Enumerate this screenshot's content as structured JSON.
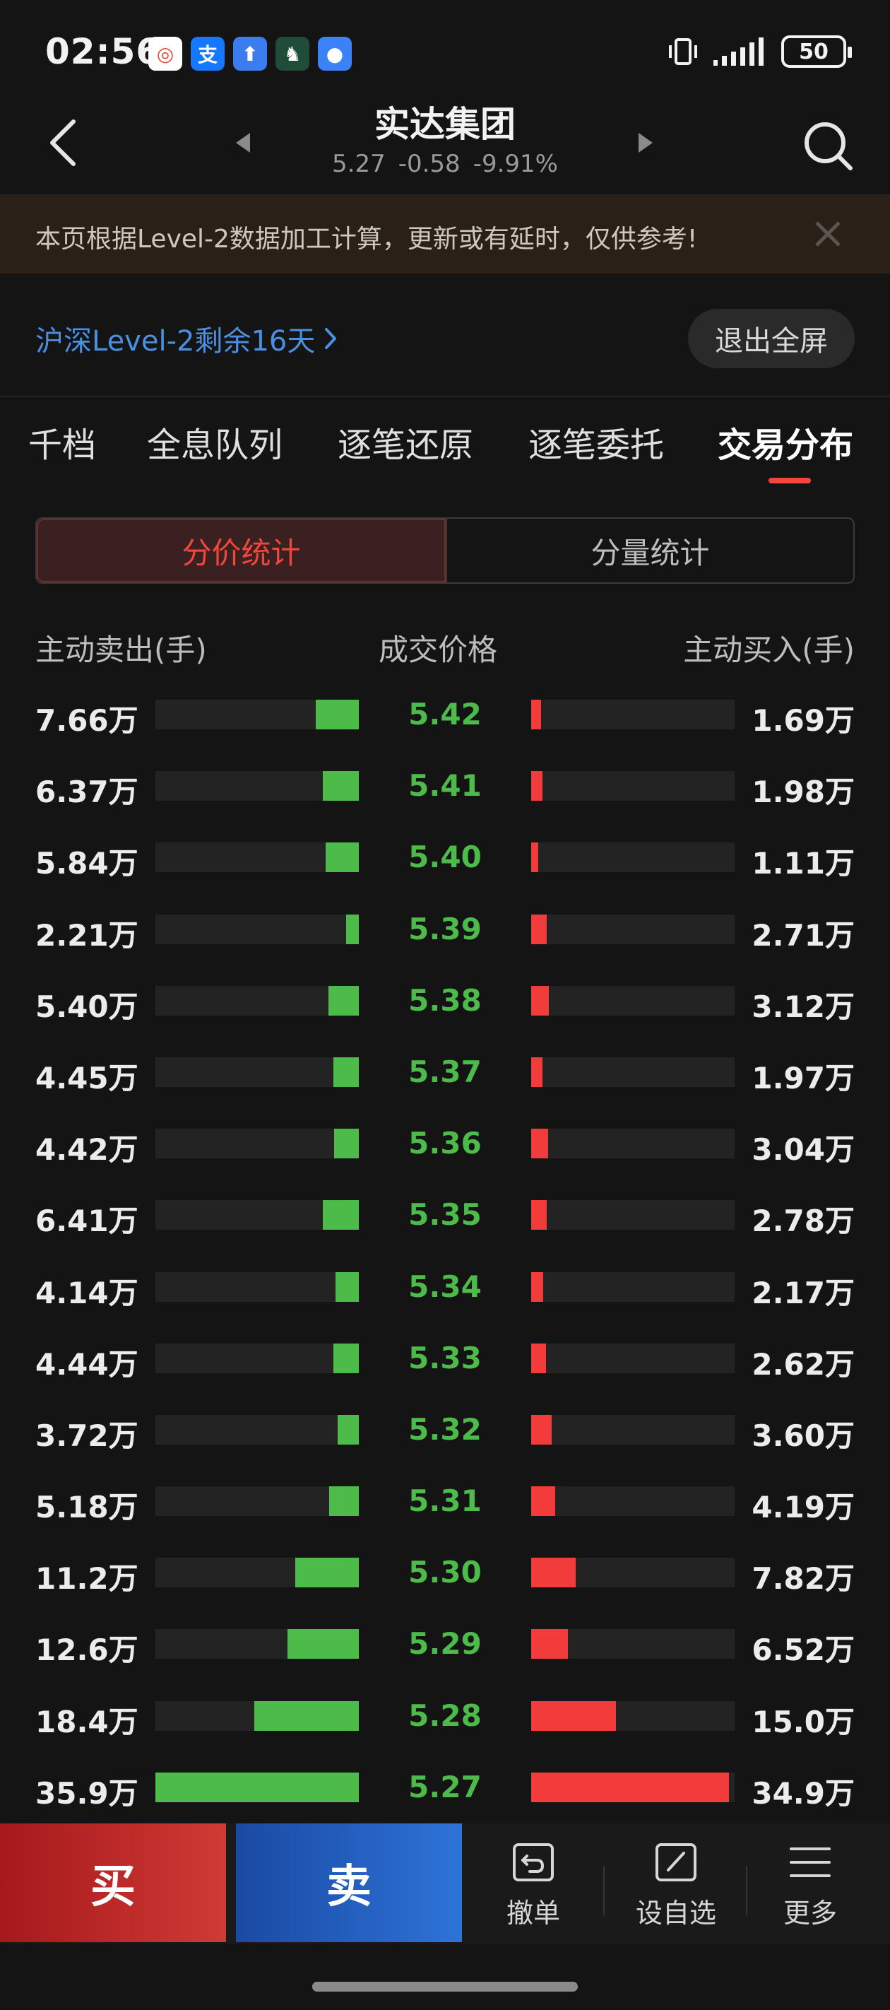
{
  "status": {
    "time": "02:56",
    "battery": "50",
    "notif_icons": [
      {
        "name": "app-icon-1",
        "glyph": "◎",
        "color": "#ffffff"
      },
      {
        "name": "alipay-icon",
        "glyph": "支",
        "color": "#1677ff"
      },
      {
        "name": "upload-app-icon",
        "glyph": "⬆",
        "color": "#3b7cf0"
      },
      {
        "name": "app-icon-4",
        "glyph": "♞",
        "color": "#1f4d3a"
      },
      {
        "name": "message-app-icon",
        "glyph": "●",
        "color": "#3b82f6"
      }
    ]
  },
  "header": {
    "stock_name": "实达集团",
    "price": "5.27",
    "change": "-0.58",
    "change_pct": "-9.91%"
  },
  "notice": {
    "text": "本页根据Level-2数据加工计算，更新或有延时，仅供参考!"
  },
  "level2": {
    "link_text": "沪深Level-2剩余16天",
    "exit_fullscreen": "退出全屏"
  },
  "tabs": [
    "千档",
    "全息队列",
    "逐笔还原",
    "逐笔委托",
    "交易分布"
  ],
  "active_tab": 4,
  "segments": [
    "分价统计",
    "分量统计"
  ],
  "table_head": {
    "sell": "主动卖出(手)",
    "price": "成交价格",
    "buy": "主动买入(手)"
  },
  "rows": [
    {
      "sell": "7.66万",
      "price": "5.42",
      "buy": "1.69万",
      "sell_val": 7.66,
      "buy_val": 1.69
    },
    {
      "sell": "6.37万",
      "price": "5.41",
      "buy": "1.98万",
      "sell_val": 6.37,
      "buy_val": 1.98
    },
    {
      "sell": "5.84万",
      "price": "5.40",
      "buy": "1.11万",
      "sell_val": 5.84,
      "buy_val": 1.11
    },
    {
      "sell": "2.21万",
      "price": "5.39",
      "buy": "2.71万",
      "sell_val": 2.21,
      "buy_val": 2.71
    },
    {
      "sell": "5.40万",
      "price": "5.38",
      "buy": "3.12万",
      "sell_val": 5.4,
      "buy_val": 3.12
    },
    {
      "sell": "4.45万",
      "price": "5.37",
      "buy": "1.97万",
      "sell_val": 4.45,
      "buy_val": 1.97
    },
    {
      "sell": "4.42万",
      "price": "5.36",
      "buy": "3.04万",
      "sell_val": 4.42,
      "buy_val": 3.04
    },
    {
      "sell": "6.41万",
      "price": "5.35",
      "buy": "2.78万",
      "sell_val": 6.41,
      "buy_val": 2.78
    },
    {
      "sell": "4.14万",
      "price": "5.34",
      "buy": "2.17万",
      "sell_val": 4.14,
      "buy_val": 2.17
    },
    {
      "sell": "4.44万",
      "price": "5.33",
      "buy": "2.62万",
      "sell_val": 4.44,
      "buy_val": 2.62
    },
    {
      "sell": "3.72万",
      "price": "5.32",
      "buy": "3.60万",
      "sell_val": 3.72,
      "buy_val": 3.6
    },
    {
      "sell": "5.18万",
      "price": "5.31",
      "buy": "4.19万",
      "sell_val": 5.18,
      "buy_val": 4.19
    },
    {
      "sell": "11.2万",
      "price": "5.30",
      "buy": "7.82万",
      "sell_val": 11.2,
      "buy_val": 7.82
    },
    {
      "sell": "12.6万",
      "price": "5.29",
      "buy": "6.52万",
      "sell_val": 12.6,
      "buy_val": 6.52
    },
    {
      "sell": "18.4万",
      "price": "5.28",
      "buy": "15.0万",
      "sell_val": 18.4,
      "buy_val": 15.0
    },
    {
      "sell": "35.9万",
      "price": "5.27",
      "buy": "34.9万",
      "sell_val": 35.9,
      "buy_val": 34.9
    }
  ],
  "bottom": {
    "buy": "买",
    "sell": "卖",
    "cancel": "撤单",
    "watchlist": "设自选",
    "more": "更多"
  },
  "colors": {
    "sell_green": "#4cbb4a",
    "buy_red": "#f23c3c",
    "accent_red": "#f0463c",
    "link_blue": "#4a90e2"
  }
}
